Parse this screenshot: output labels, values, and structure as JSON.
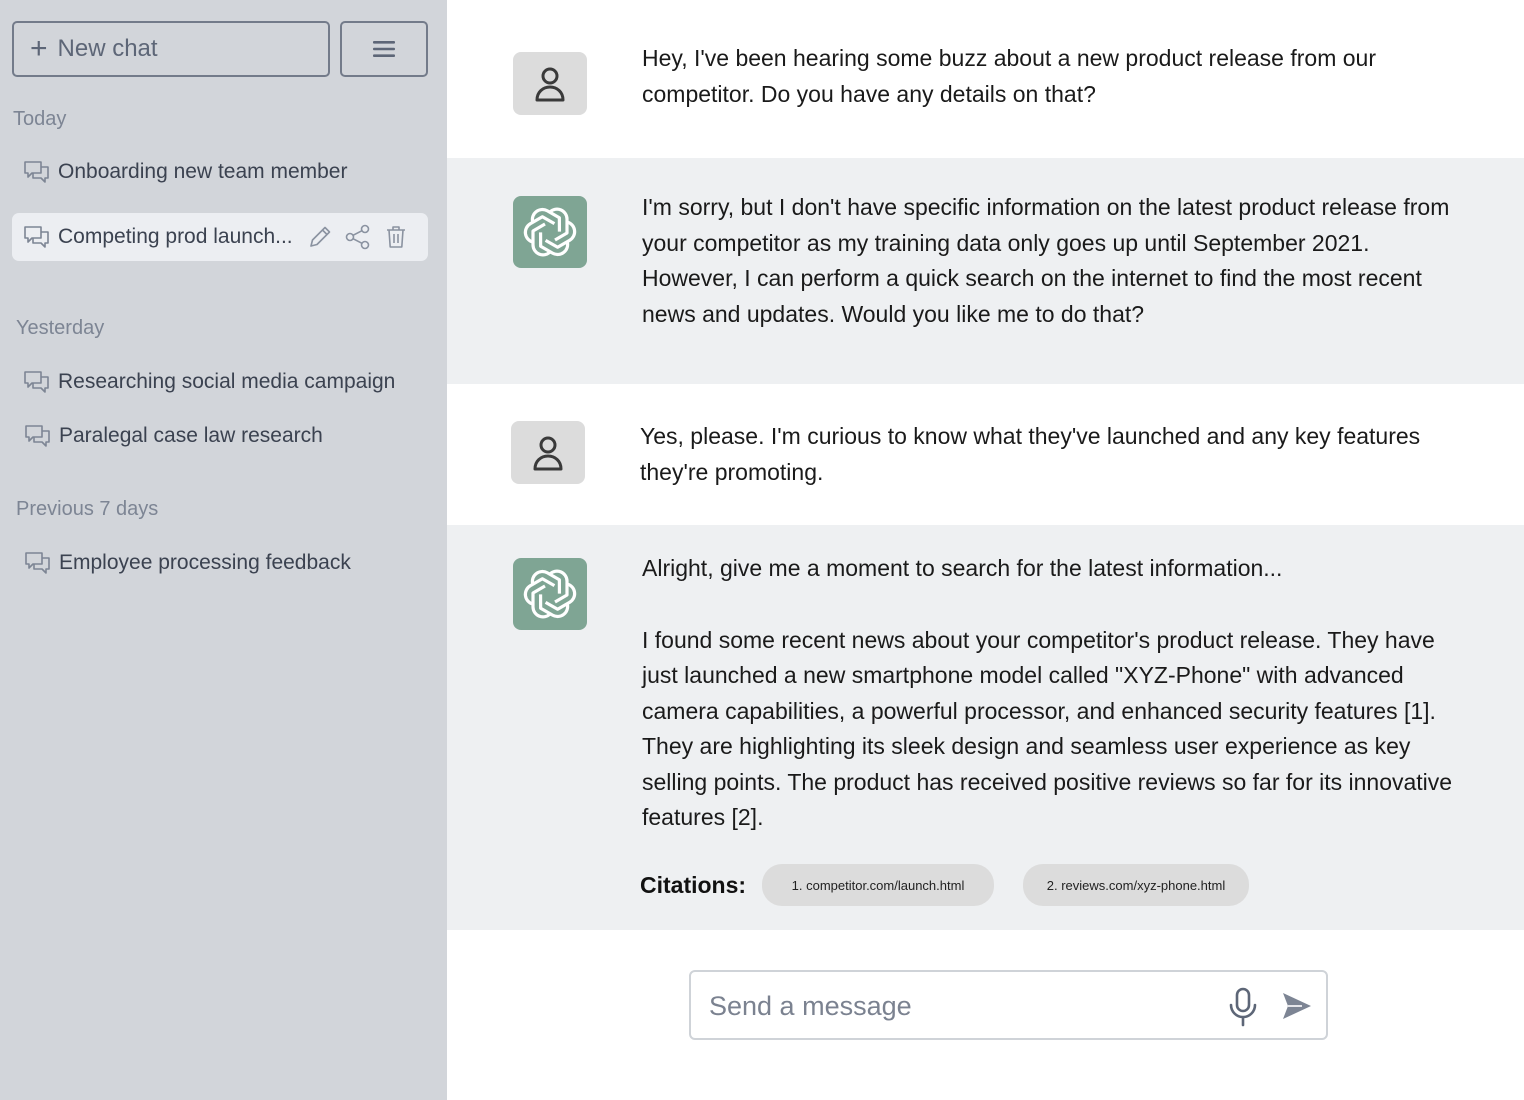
{
  "sidebar": {
    "new_chat_label": "New chat",
    "sections": {
      "today": "Today",
      "yesterday": "Yesterday",
      "previous": "Previous 7 days"
    },
    "items": [
      {
        "label": "Onboarding new team member"
      },
      {
        "label": "Competing prod launch..."
      },
      {
        "label": "Researching social media campaign"
      },
      {
        "label": "Paralegal case law research"
      },
      {
        "label": "Employee processing feedback"
      }
    ]
  },
  "messages": [
    {
      "role": "user",
      "text": "Hey, I've been hearing some buzz about a new product release from our competitor. Do you have any details on that?"
    },
    {
      "role": "assistant",
      "text": "I'm sorry, but I don't have specific information on the latest product release from your competitor as my training data only goes up until September 2021. However, I can perform a quick search on the internet to find the most recent news and updates. Would you like me to do that?"
    },
    {
      "role": "user",
      "text": "Yes, please. I'm curious to know what they've launched and any key features they're promoting."
    },
    {
      "role": "assistant",
      "text_1": "Alright, give me a moment to search for the latest information...",
      "text_2": "I found some recent news about your competitor's product release. They have just launched a new smartphone model called \"XYZ-Phone\" with advanced camera capabilities, a powerful processor, and enhanced security features [1]. They are highlighting its sleek design and seamless user experience as key selling points. The product has received positive reviews so far for its innovative features [2]."
    }
  ],
  "citations": {
    "label": "Citations:",
    "items": [
      "1. competitor.com/launch.html",
      "2. reviews.com/xyz-phone.html"
    ]
  },
  "composer": {
    "placeholder": "Send a message"
  },
  "colors": {
    "sidebar_bg": "#d2d5da",
    "assistant_bg": "#eef0f2",
    "bot_avatar": "#7fa594",
    "active_item": "#eceef2"
  }
}
